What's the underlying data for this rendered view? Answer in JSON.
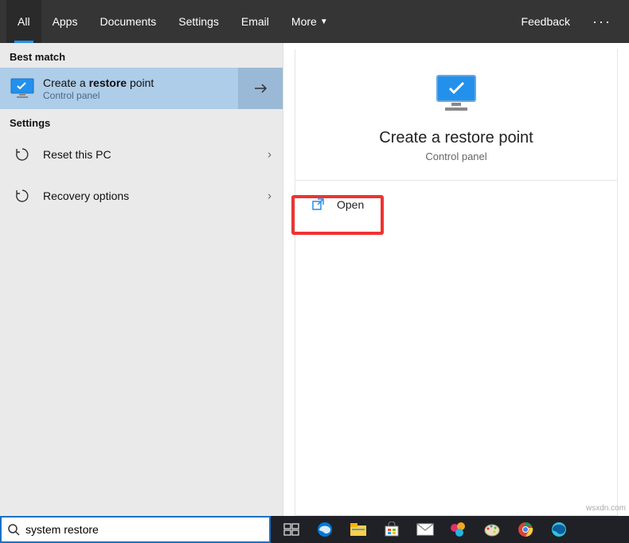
{
  "tabs": {
    "all": "All",
    "apps": "Apps",
    "documents": "Documents",
    "settings": "Settings",
    "email": "Email",
    "more": "More",
    "feedback": "Feedback"
  },
  "left": {
    "best_match_label": "Best match",
    "best_match": {
      "title_pre": "Create a ",
      "title_bold": "restore",
      "title_post": " point",
      "subtitle": "Control panel"
    },
    "settings_label": "Settings",
    "settings_items": [
      {
        "label": "Reset this PC"
      },
      {
        "label": "Recovery options"
      }
    ]
  },
  "detail": {
    "title": "Create a restore point",
    "subtitle": "Control panel",
    "open_label": "Open"
  },
  "search": {
    "value": "system restore"
  },
  "watermark": "wsxdn.com"
}
